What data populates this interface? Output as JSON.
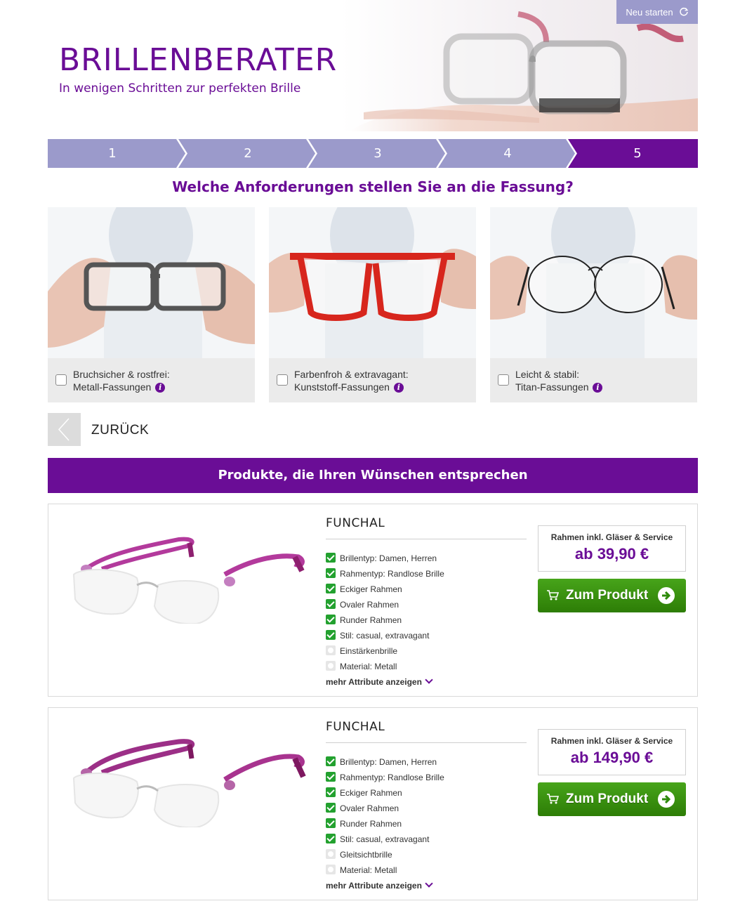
{
  "header": {
    "title": "BRILLENBERATER",
    "subtitle": "In wenigen Schritten zur perfekten Brille",
    "restart_label": "Neu starten",
    "restart_icon": "refresh-icon"
  },
  "steps": {
    "items": [
      "1",
      "2",
      "3",
      "4",
      "5"
    ],
    "active": "5",
    "colors": {
      "inactive": "#9b9acb",
      "active": "#6a0d96"
    }
  },
  "question": "Welche Anforderungen stellen Sie an die Fassung?",
  "options": [
    {
      "line1": "Bruchsicher & rostfrei:",
      "line2": "Metall-Fassungen",
      "checked": false,
      "image": "grey-glasses-held-photo"
    },
    {
      "line1": "Farbenfroh & extravagant:",
      "line2": "Kunststoff-Fassungen",
      "checked": false,
      "image": "red-glasses-held-photo"
    },
    {
      "line1": "Leicht & stabil:",
      "line2": "Titan-Fassungen",
      "checked": false,
      "image": "thin-wire-glasses-held-photo"
    }
  ],
  "info_glyph": "i",
  "back_label": "ZURÜCK",
  "results_title": "Produkte, die Ihren Wünschen entsprechen",
  "products": [
    {
      "name": "FUNCHAL",
      "attributes": [
        {
          "label": "Brillentyp: Damen, Herren",
          "match": true
        },
        {
          "label": "Rahmentyp: Randlose Brille",
          "match": true
        },
        {
          "label": "Eckiger Rahmen",
          "match": true
        },
        {
          "label": "Ovaler Rahmen",
          "match": true
        },
        {
          "label": "Runder Rahmen",
          "match": true
        },
        {
          "label": "Stil: casual, extravagant",
          "match": true
        },
        {
          "label": "Einstärkenbrille",
          "match": false
        },
        {
          "label": "Material: Metall",
          "match": false
        }
      ],
      "more_label": "mehr Attribute anzeigen",
      "price_label": "Rahmen inkl. Gläser & Service",
      "price": "ab 39,90 €",
      "button_label": "Zum Produkt"
    },
    {
      "name": "FUNCHAL",
      "attributes": [
        {
          "label": "Brillentyp: Damen, Herren",
          "match": true
        },
        {
          "label": "Rahmentyp: Randlose Brille",
          "match": true
        },
        {
          "label": "Eckiger Rahmen",
          "match": true
        },
        {
          "label": "Ovaler Rahmen",
          "match": true
        },
        {
          "label": "Runder Rahmen",
          "match": true
        },
        {
          "label": "Stil: casual, extravagant",
          "match": true
        },
        {
          "label": "Gleitsichtbrille",
          "match": false
        },
        {
          "label": "Material: Metall",
          "match": false
        }
      ],
      "more_label": "mehr Attribute anzeigen",
      "price_label": "Rahmen inkl. Gläser & Service",
      "price": "ab 149,90 €",
      "button_label": "Zum Produkt"
    }
  ]
}
